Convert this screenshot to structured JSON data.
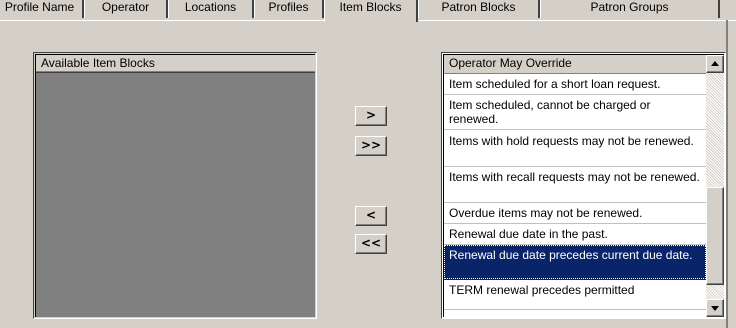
{
  "tabs": [
    {
      "label": "Profile Name"
    },
    {
      "label": "Operator"
    },
    {
      "label": "Locations"
    },
    {
      "label": "Profiles"
    },
    {
      "label": "Item Blocks",
      "active": true
    },
    {
      "label": "Patron Blocks"
    },
    {
      "label": "Patron Groups"
    }
  ],
  "left_list": {
    "header": "Available Item Blocks",
    "items": []
  },
  "buttons": {
    "add": ">",
    "add_all": ">>",
    "remove": "<",
    "remove_all": "<<"
  },
  "right_list": {
    "header": "Operator May Override",
    "items": [
      {
        "text": "Item scheduled for a short loan request."
      },
      {
        "text": "Item scheduled, cannot be charged or renewed."
      },
      {
        "text": "Items with hold requests may not be renewed."
      },
      {
        "text": "Items with recall requests may not be renewed."
      },
      {
        "text": "Overdue items may not be renewed."
      },
      {
        "text": "Renewal due date in the past."
      },
      {
        "text": "Renewal due date precedes current due date.",
        "selected": true
      },
      {
        "text": "TERM renewal precedes permitted"
      }
    ]
  },
  "colors": {
    "window_bg": "#d4d0c8",
    "list_empty_bg": "#808080",
    "selection_bg": "#0a246a",
    "selection_text": "#ffffff"
  }
}
